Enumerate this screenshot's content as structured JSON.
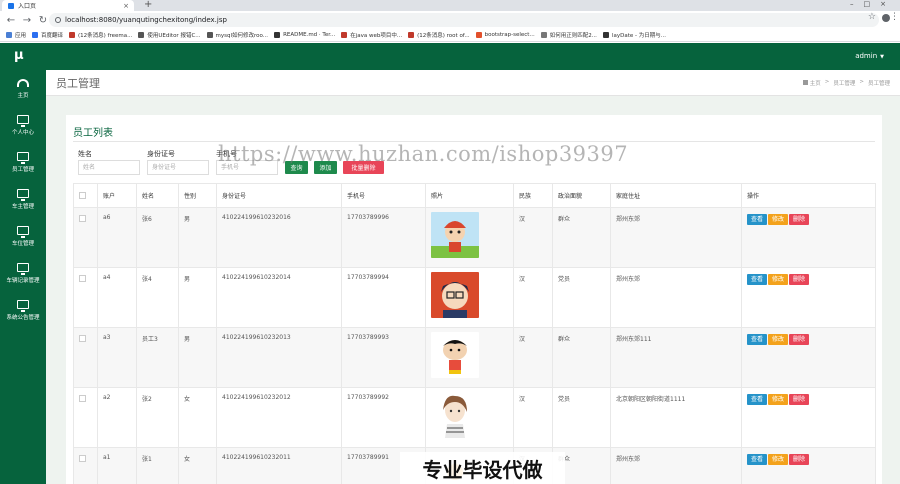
{
  "browser": {
    "tab_title": "入口页",
    "url": "localhost:8080/yuanqutingchexitong/index.jsp",
    "bookmarks": [
      {
        "label": "应用",
        "color": "#4a7fd4"
      },
      {
        "label": "百度翻译",
        "color": "#2b6ff0"
      },
      {
        "label": "(12条消息) freema...",
        "color": "#c0392b"
      },
      {
        "label": "使用UEditor 报错C...",
        "color": "#555555"
      },
      {
        "label": "mysql如何修改roo...",
        "color": "#555555"
      },
      {
        "label": "README.md · Ter...",
        "color": "#333333"
      },
      {
        "label": "在java web项目中...",
        "color": "#c0392b"
      },
      {
        "label": "(12条消息) root of...",
        "color": "#c0392b"
      },
      {
        "label": "bootstrap-select...",
        "color": "#e2502b"
      },
      {
        "label": "如何用正则匹配2...",
        "color": "#777777"
      },
      {
        "label": "layDate - 为日期与...",
        "color": "#333333"
      }
    ]
  },
  "header": {
    "logo": "μ",
    "user": "admin"
  },
  "sidebar": {
    "items": [
      {
        "label": "主页",
        "icon": "dashboard-icon"
      },
      {
        "label": "个人中心",
        "icon": "monitor-icon"
      },
      {
        "label": "员工管理",
        "icon": "monitor-icon"
      },
      {
        "label": "车主管理",
        "icon": "monitor-icon"
      },
      {
        "label": "车位管理",
        "icon": "monitor-icon"
      },
      {
        "label": "车辆记录管理",
        "icon": "monitor-icon"
      },
      {
        "label": "系统公告管理",
        "icon": "monitor-icon"
      }
    ]
  },
  "page": {
    "title": "员工管理",
    "breadcrumb": [
      "主页",
      "员工管理",
      "员工管理"
    ]
  },
  "panel": {
    "title": "员工列表",
    "search": {
      "name_label": "姓名",
      "name_placeholder": "姓名",
      "id_label": "身份证号",
      "id_placeholder": "身份证号",
      "phone_label": "手机号",
      "phone_placeholder": "手机号"
    },
    "buttons": {
      "search": "查询",
      "add": "添加",
      "batch_delete": "批量删除"
    }
  },
  "table": {
    "headers": [
      "账户",
      "姓名",
      "性别",
      "身份证号",
      "手机号",
      "照片",
      "民族",
      "政治面貌",
      "家庭住址",
      "操作"
    ],
    "actions": {
      "view": "查看",
      "edit": "修改",
      "delete": "删除"
    },
    "rows": [
      {
        "account": "a6",
        "name": "张6",
        "gender": "男",
        "id_number": "410224199610232016",
        "phone": "17703789996",
        "ethnicity": "汉",
        "political": "群众",
        "address": "郑州东郊"
      },
      {
        "account": "a4",
        "name": "张4",
        "gender": "男",
        "id_number": "410224199610232014",
        "phone": "17703789994",
        "ethnicity": "汉",
        "political": "党员",
        "address": "郑州东郊"
      },
      {
        "account": "a3",
        "name": "员工3",
        "gender": "男",
        "id_number": "410224199610232013",
        "phone": "17703789993",
        "ethnicity": "汉",
        "political": "群众",
        "address": "郑州东郊111"
      },
      {
        "account": "a2",
        "name": "张2",
        "gender": "女",
        "id_number": "410224199610232012",
        "phone": "17703789992",
        "ethnicity": "汉",
        "political": "党员",
        "address": "北京朝阳区朝阳街道1111"
      },
      {
        "account": "a1",
        "name": "张1",
        "gender": "女",
        "id_number": "410224199610232011",
        "phone": "17703789991",
        "ethnicity": "汉",
        "political": "群众",
        "address": "郑州东郊"
      }
    ]
  },
  "overlays": {
    "watermark_url": "https://www.huzhan.com/ishop39397",
    "watermark_text": "专业毕设代做"
  },
  "colors": {
    "brand": "#06633d",
    "view": "#2593c9",
    "edit": "#f3a21c",
    "delete": "#e84558",
    "primary_btn": "#1e8a4c"
  }
}
